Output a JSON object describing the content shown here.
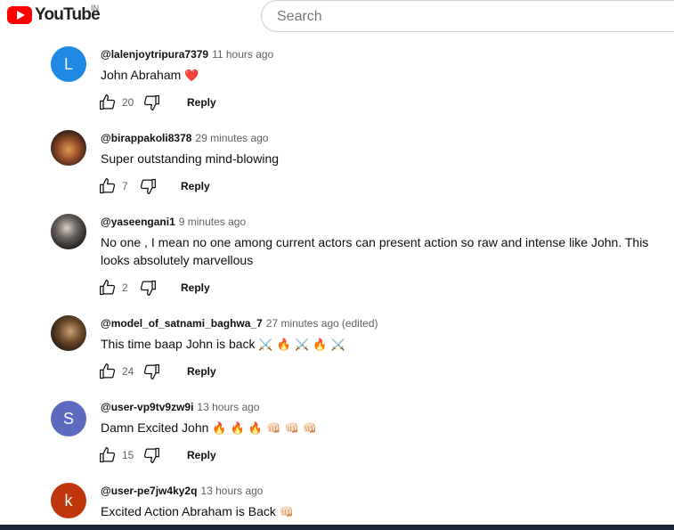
{
  "header": {
    "logo_text": "YouTube",
    "country_code": "IN",
    "search_placeholder": "Search"
  },
  "comments": [
    {
      "author": "@lalenjoytripura7379",
      "time": "11 hours ago",
      "text": "John Abraham",
      "emoji": "❤️",
      "likes": "20",
      "avatar_letter": "L",
      "avatar_color": "#1e88e5",
      "reply_label": "Reply"
    },
    {
      "author": "@birappakoli8378",
      "time": "29 minutes ago",
      "text": "Super outstanding mind-blowing",
      "emoji": "",
      "likes": "7",
      "avatar_letter": "",
      "avatar_color": "#5a3a2a",
      "reply_label": "Reply"
    },
    {
      "author": "@yaseengani1",
      "time": "9 minutes ago",
      "text": "No one , I mean no one among current actors can present action so raw and intense like John. This looks absolutely marvellous",
      "emoji": "",
      "likes": "2",
      "avatar_letter": "",
      "avatar_color": "#3a3a3a",
      "reply_label": "Reply"
    },
    {
      "author": "@model_of_satnami_baghwa_7",
      "time": "27 minutes ago",
      "edited": "(edited)",
      "text": "This time baap John is back",
      "emoji": "⚔️ 🔥 ⚔️ 🔥 ⚔️",
      "likes": "24",
      "avatar_letter": "",
      "avatar_color": "#4a3a22",
      "reply_label": "Reply"
    },
    {
      "author": "@user-vp9tv9zw9i",
      "time": "13 hours ago",
      "text": "Damn Excited John",
      "emoji": "🔥 🔥 🔥 👊🏻 👊🏻 👊🏻",
      "likes": "15",
      "avatar_letter": "S",
      "avatar_color": "#5c6bc0",
      "reply_label": "Reply"
    },
    {
      "author": "@user-pe7jw4ky2q",
      "time": "13 hours ago",
      "text": "Excited Action Abraham is Back",
      "emoji": "👊🏻",
      "likes": "",
      "avatar_letter": "k",
      "avatar_color": "#bf360c",
      "reply_label": ""
    }
  ]
}
